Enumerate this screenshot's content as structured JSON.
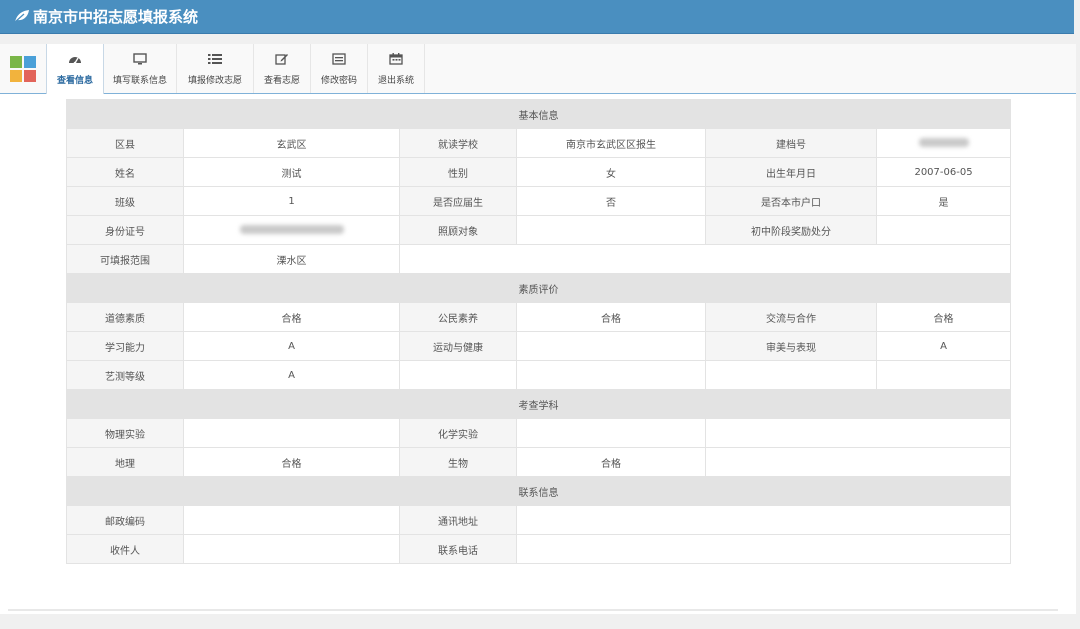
{
  "app": {
    "title": "南京市中招志愿填报系统"
  },
  "tabs": [
    {
      "label": "查看信息",
      "icon": "dashboard-icon",
      "active": true
    },
    {
      "label": "填写联系信息",
      "icon": "monitor-icon",
      "active": false
    },
    {
      "label": "填报修改志愿",
      "icon": "list-icon",
      "active": false
    },
    {
      "label": "查看志愿",
      "icon": "edit-icon",
      "active": false
    },
    {
      "label": "修改密码",
      "icon": "card-icon",
      "active": false
    },
    {
      "label": "退出系统",
      "icon": "calendar-icon",
      "active": false
    }
  ],
  "basic": {
    "section": "基本信息",
    "district_k": "区县",
    "district_v": "玄武区",
    "school_k": "就读学校",
    "school_v": "南京市玄武区区报生",
    "fileno_k": "建档号",
    "name_k": "姓名",
    "name_v": "测试",
    "gender_k": "性别",
    "gender_v": "女",
    "birth_k": "出生年月日",
    "birth_v": "2007-06-05",
    "class_k": "班级",
    "class_v": "1",
    "fresh_k": "是否应届生",
    "fresh_v": "否",
    "local_k": "是否本市户口",
    "local_v": "是",
    "id_k": "身份证号",
    "care_k": "照顾对象",
    "care_v": "",
    "award_k": "初中阶段奖励处分",
    "award_v": "",
    "range_k": "可填报范围",
    "range_v": "溧水区"
  },
  "quality": {
    "section": "素质评价",
    "moral_k": "道德素质",
    "moral_v": "合格",
    "civic_k": "公民素养",
    "civic_v": "合格",
    "comm_k": "交流与合作",
    "comm_v": "合格",
    "learn_k": "学习能力",
    "learn_v": "A",
    "sport_k": "运动与健康",
    "sport_v": "",
    "aes_k": "审美与表现",
    "aes_v": "A",
    "art_k": "艺测等级",
    "art_v": "A"
  },
  "exam": {
    "section": "考查学科",
    "phys_k": "物理实验",
    "phys_v": "",
    "chem_k": "化学实验",
    "chem_v": "",
    "geo_k": "地理",
    "geo_v": "合格",
    "bio_k": "生物",
    "bio_v": "合格"
  },
  "contact": {
    "section": "联系信息",
    "zip_k": "邮政编码",
    "zip_v": "",
    "addr_k": "通讯地址",
    "addr_v": "",
    "recv_k": "收件人",
    "recv_v": "",
    "phone_k": "联系电话",
    "phone_v": ""
  },
  "colors": {
    "header": "#4a8fc0",
    "section": "#e3e3e3",
    "keycell": "#f5f5f5",
    "active_tab_text": "#2c6aa0"
  }
}
